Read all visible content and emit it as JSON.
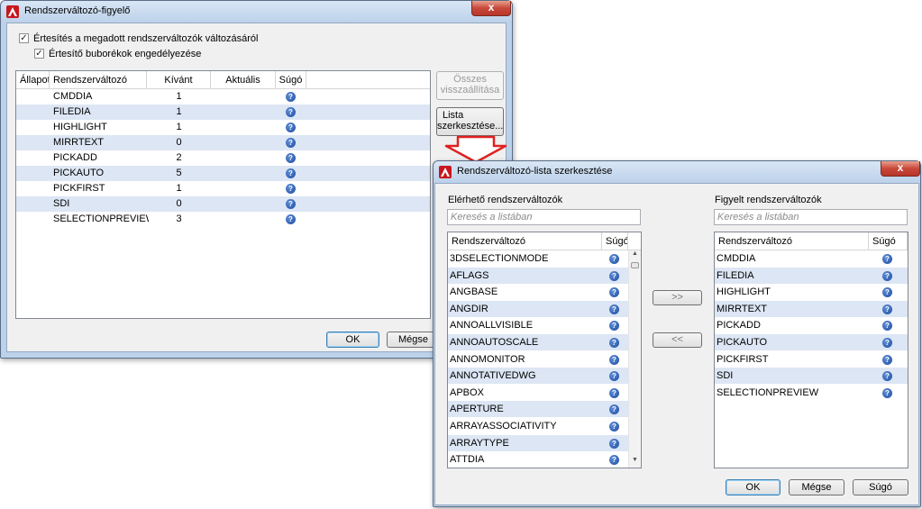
{
  "watcher": {
    "title": "Rendszerváltozó-figyelő",
    "close_glyph": "x",
    "notify_checkbox": {
      "label": "Értesítés a megadott rendszerváltozók változásáról",
      "checked": true
    },
    "balloon_checkbox": {
      "label": "Értesítő buborékok engedélyezése",
      "checked": true
    },
    "columns": [
      "Állapot",
      "Rendszerváltozó",
      "Kívánt",
      "Aktuális",
      "Súgó"
    ],
    "rows": [
      {
        "name": "CMDDIA",
        "desired": "1",
        "current": ""
      },
      {
        "name": "FILEDIA",
        "desired": "1",
        "current": ""
      },
      {
        "name": "HIGHLIGHT",
        "desired": "1",
        "current": ""
      },
      {
        "name": "MIRRTEXT",
        "desired": "0",
        "current": ""
      },
      {
        "name": "PICKADD",
        "desired": "2",
        "current": ""
      },
      {
        "name": "PICKAUTO",
        "desired": "5",
        "current": ""
      },
      {
        "name": "PICKFIRST",
        "desired": "1",
        "current": ""
      },
      {
        "name": "SDI",
        "desired": "0",
        "current": ""
      },
      {
        "name": "SELECTIONPREVIEW",
        "desired": "3",
        "current": ""
      }
    ],
    "reset_all_button": {
      "line1": "Összes",
      "line2": "visszaállítása"
    },
    "edit_list_button": {
      "line1": "Lista",
      "line2": "szerkesztése..."
    },
    "ok_label": "OK",
    "cancel_label": "Mégse"
  },
  "editor": {
    "title": "Rendszerváltozó-lista szerkesztése",
    "close_glyph": "x",
    "available_label": "Elérhető rendszerváltozók",
    "available_search_placeholder": "Keresés a listában",
    "available_columns": [
      "Rendszerváltozó",
      "Súgó"
    ],
    "available_items": [
      "3DSELECTIONMODE",
      "AFLAGS",
      "ANGBASE",
      "ANGDIR",
      "ANNOALLVISIBLE",
      "ANNOAUTOSCALE",
      "ANNOMONITOR",
      "ANNOTATIVEDWG",
      "APBOX",
      "APERTURE",
      "ARRAYASSOCIATIVITY",
      "ARRAYTYPE",
      "ATTDIA"
    ],
    "add_button": ">>",
    "remove_button": "<<",
    "watched_label": "Figyelt rendszerváltozók",
    "watched_search_placeholder": "Keresés a listában",
    "watched_columns": [
      "Rendszerváltozó",
      "Súgó"
    ],
    "watched_items": [
      "CMDDIA",
      "FILEDIA",
      "HIGHLIGHT",
      "MIRRTEXT",
      "PICKADD",
      "PICKAUTO",
      "PICKFIRST",
      "SDI",
      "SELECTIONPREVIEW"
    ],
    "ok_label": "OK",
    "cancel_label": "Mégse",
    "help_label": "Súgó"
  },
  "icons": {
    "app": "autocad-logo-icon",
    "help": "help-question-icon",
    "arrow": "red-down-arrow-icon"
  },
  "colors": {
    "row_alt": "#dce6f4",
    "close_red": "#c9483a",
    "arrow_red": "#e02020",
    "help_blue": "#1c4aa0"
  }
}
